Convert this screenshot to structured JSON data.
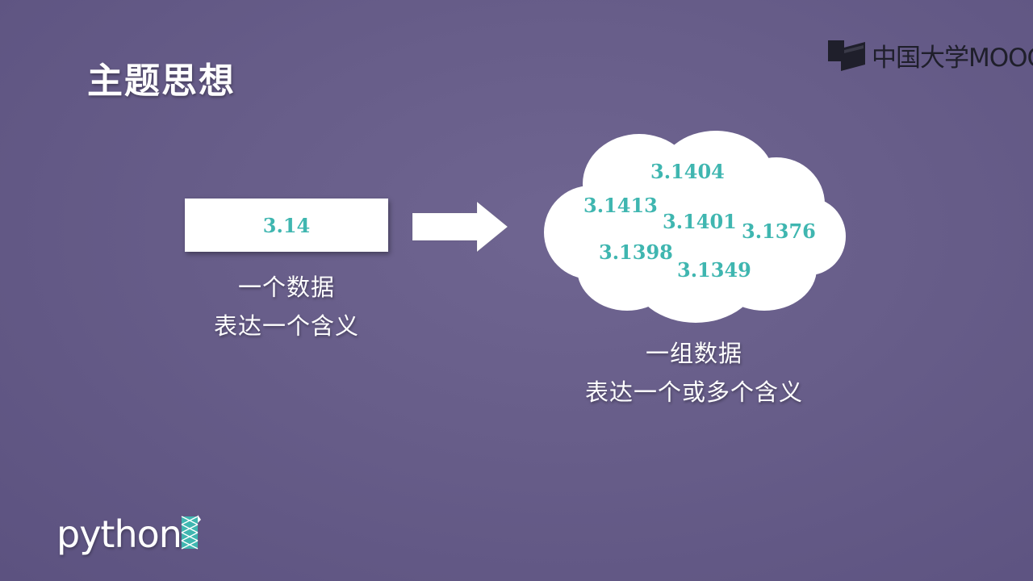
{
  "slide": {
    "title": "主题思想",
    "left": {
      "value": "3.14",
      "caption_line1": "一个数据",
      "caption_line2": "表达一个含义"
    },
    "right": {
      "numbers": [
        "3.1404",
        "3.1413",
        "3.1401",
        "3.1376",
        "3.1398",
        "3.1349"
      ],
      "caption_line1": "一组数据",
      "caption_line2": "表达一个或多个含义"
    }
  },
  "branding": {
    "mooc_text": "中国大学MOOC",
    "python_text": "python"
  },
  "colors": {
    "background": "#675d89",
    "accent_teal": "#3fb6b0",
    "white": "#ffffff"
  },
  "icons": {
    "arrow": "right-arrow-icon",
    "cloud": "cloud-icon",
    "mooc_logo": "book-icon"
  }
}
